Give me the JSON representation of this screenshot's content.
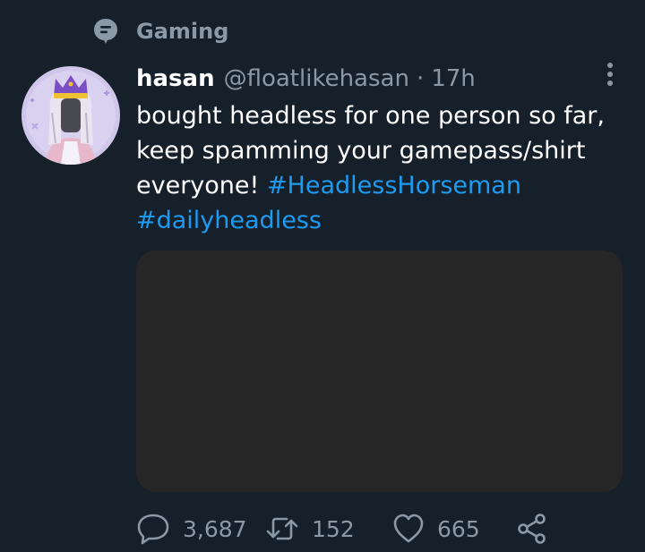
{
  "topic": {
    "label": "Gaming",
    "icon": "topic-icon"
  },
  "tweet": {
    "author_name": "hasan",
    "author_handle": "@floatlikehasan",
    "separator": "·",
    "time": "17h",
    "text_lines": [
      "bought headless for one person so far,",
      "keep spamming your gamepass/shirt",
      "everyone! "
    ],
    "hashtags": [
      "#HeadlessHorseman",
      "#dailyheadless"
    ],
    "actions": {
      "replies": "3,687",
      "retweets": "152",
      "likes": "665"
    }
  },
  "colors": {
    "background": "#15202b",
    "muted": "#8b98a5",
    "link": "#1d9bf0",
    "media_placeholder": "#262626"
  }
}
